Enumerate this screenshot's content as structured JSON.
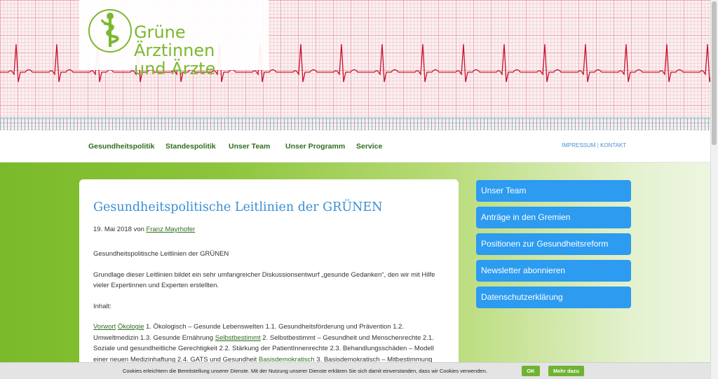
{
  "logo": {
    "line1": "Grüne Ärztinnen",
    "line2": "und Ärzte"
  },
  "nav": {
    "items": [
      {
        "label": "Gesundheitspolitik"
      },
      {
        "label": "Standespolitik"
      },
      {
        "label": "Unser Team"
      },
      {
        "label": "Unser Programm"
      },
      {
        "label": "Service"
      }
    ],
    "impressum": "IMPRESSUM",
    "separator": "|",
    "kontakt": "KONTAKT"
  },
  "article": {
    "title": "Gesundheitspolitische Leitlinien der GRÜNEN",
    "date_prefix": "19. Mai 2018 von",
    "author": "Franz Mayrhofer",
    "p1": "Gesundheitspolitische Leitlinien der GRÜNEN",
    "p2": "Grundlage dieser Leitlinien bildet ein sehr umfangreicher Diskussionsentwurf „gesunde Gedanken“, den wir mit Hilfe vieler Expertinnen und Experten erstellten.",
    "p3": "Inhalt:",
    "p4_link_vorwort": "Vorwort",
    "p4_link_oekologie": "Ökologie",
    "p4_text1": " 1. Ökologisch – Gesunde Lebenswelten 1.1. Gesundheitsförderung und Prävention 1.2. Umweltmedizin 1.3. Gesunde Ernährung ",
    "p4_link_selbst": "Selbstbestimmt",
    "p4_text2": " 2. Selbstbestimmt – Gesundheit und Menschenrechte 2.1. Soziale und gesundheitliche Gerechtigkeit 2.2. Stärkung der PatientInnenrechte 2.3. Behandlungsschäden – Modell einer neuen Medizinhaftung 2.4. GATS und Gesundheit ",
    "p4_link_basis": "Basisdemokratisch",
    "p4_text3": " 3. Basisdemokratisch – Mitbestimmung"
  },
  "sidebar": {
    "items": [
      {
        "label": "Unser Team"
      },
      {
        "label": "Anträge in den Gremien"
      },
      {
        "label": "Positionen zur Gesundheitsreform"
      },
      {
        "label": "Newsletter abonnieren"
      },
      {
        "label": "Datenschutzerklärung"
      }
    ]
  },
  "cookie": {
    "text": "Cookies erleichtern die Bereitstellung unserer Dienste. Mit der Nutzung unserer Dienste erklären Sie sich damit einverstanden, dass wir Cookies verwenden.",
    "ok": "OK",
    "more": "Mehr dazu"
  },
  "colors": {
    "brand_green": "#7cb82f",
    "nav_green": "#2e6d1e",
    "link_blue": "#3a8fd6",
    "sidebar_blue": "#2c9bf0",
    "ecg_red": "#c8102e"
  },
  "icons": {
    "logo": "caduceus-icon"
  }
}
